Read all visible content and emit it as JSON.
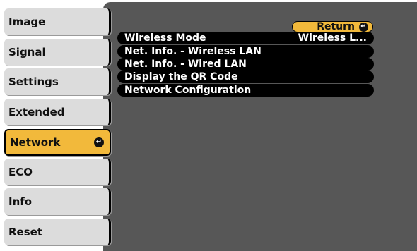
{
  "tabs": [
    {
      "label": "Image"
    },
    {
      "label": "Signal"
    },
    {
      "label": "Settings"
    },
    {
      "label": "Extended"
    },
    {
      "label": "Network",
      "active": true
    },
    {
      "label": "ECO"
    },
    {
      "label": "Info"
    },
    {
      "label": "Reset"
    }
  ],
  "return_label": "Return",
  "menu_items": [
    {
      "label": "Wireless Mode",
      "value": "Wireless L..."
    },
    {
      "label": "Net. Info. - Wireless LAN",
      "value": ""
    },
    {
      "label": "Net. Info. - Wired LAN",
      "value": ""
    },
    {
      "label": "Display the QR Code",
      "value": ""
    },
    {
      "label": "Network Configuration",
      "value": ""
    }
  ],
  "colors": {
    "panel": "#575757",
    "tab": "#dcdcdc",
    "highlight": "#f2b93b",
    "row": "#000000"
  },
  "icons": {
    "enter": "enter-icon"
  }
}
